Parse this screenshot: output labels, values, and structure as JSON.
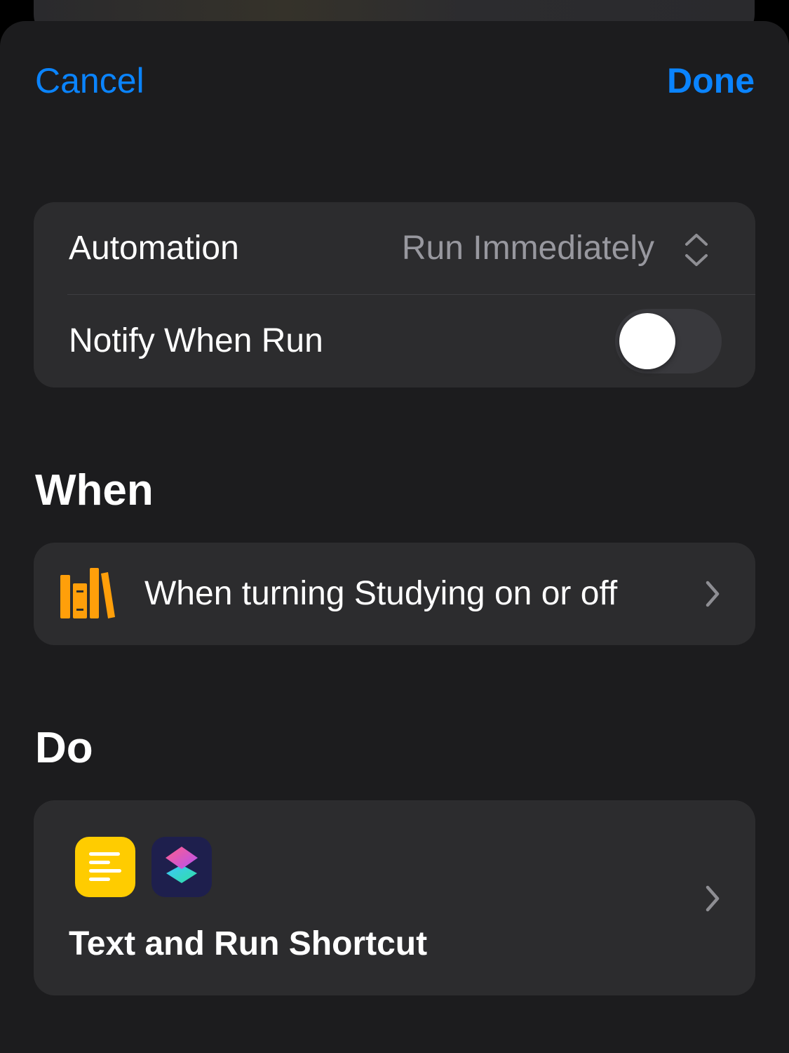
{
  "nav": {
    "cancel_label": "Cancel",
    "done_label": "Done"
  },
  "settings": {
    "automation_label": "Automation",
    "automation_value": "Run Immediately",
    "notify_label": "Notify When Run",
    "notify_on": false
  },
  "when": {
    "title": "When",
    "trigger_text": "When turning Studying on or off",
    "trigger_icon": "books-icon",
    "accent_color": "#ff9f0a"
  },
  "do": {
    "title": "Do",
    "action_text": "Text and Run Shortcut",
    "icons": [
      "text-app-icon",
      "shortcuts-app-icon"
    ]
  },
  "colors": {
    "tint": "#0a84ff",
    "background": "#1c1c1e",
    "card": "#2c2c2e"
  }
}
